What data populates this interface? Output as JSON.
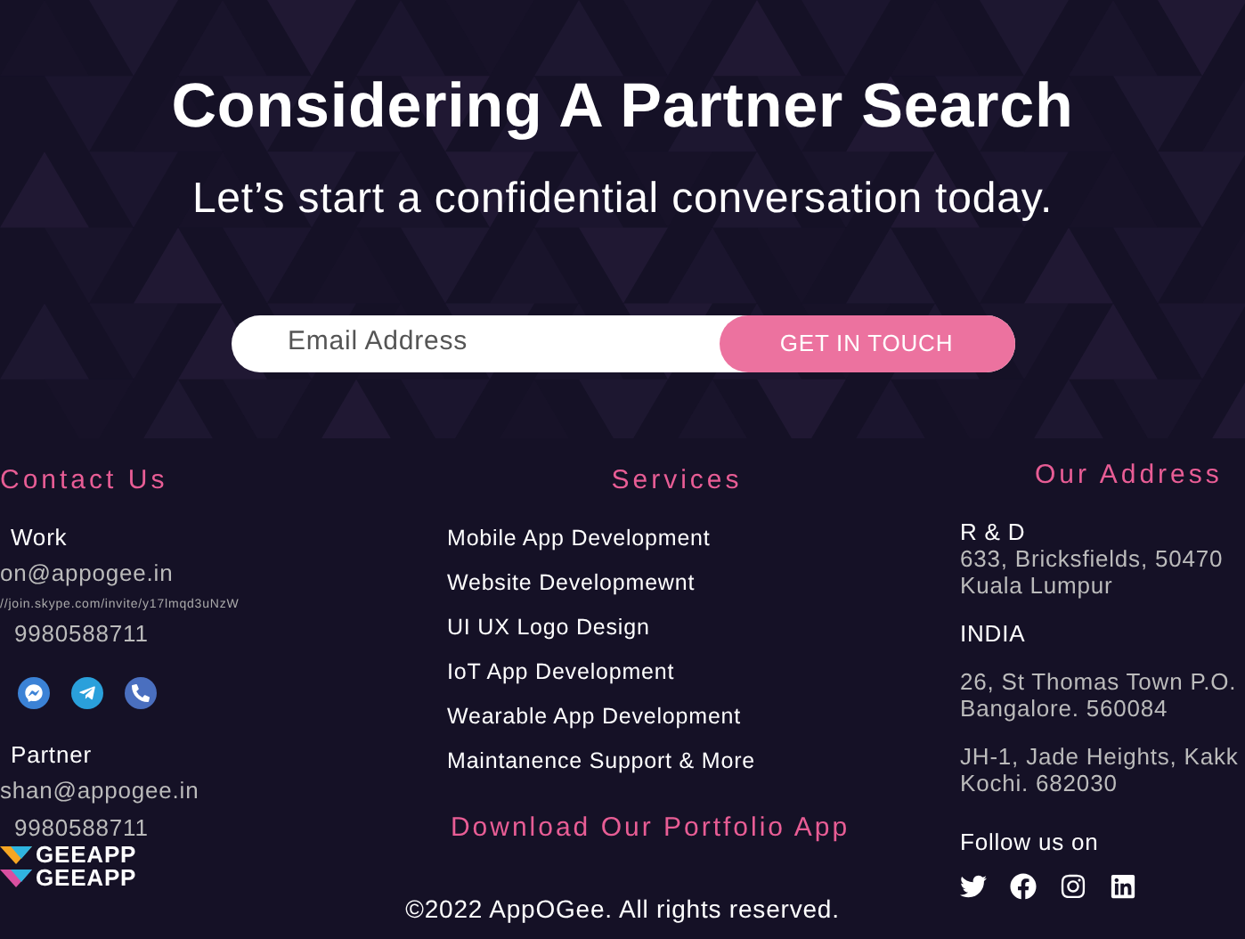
{
  "hero": {
    "title": "Considering A Partner Search",
    "subtitle": "Let’s start a confidential conversation today.",
    "email": {
      "placeholder": "Email Address"
    },
    "button": "GET IN TOUCH"
  },
  "contact": {
    "heading": "Contact Us",
    "groups": [
      {
        "label": "Work",
        "lines": [
          {
            "kind": "email",
            "text": "on@appogee.in"
          },
          {
            "kind": "link",
            "text": "//join.skype.com/invite/y17lmqd3uNzW"
          },
          {
            "kind": "phone",
            "text": "9980588711"
          }
        ],
        "quick_contact_icons": true
      },
      {
        "label": "Partner",
        "lines": [
          {
            "kind": "email",
            "text": "shan@appogee.in"
          },
          {
            "kind": "phone",
            "text": "9980588711"
          }
        ],
        "quick_contact_icons": false
      }
    ],
    "logos": [
      "GEEAPP",
      "GEEAPP"
    ]
  },
  "services": {
    "heading": "Services",
    "items": [
      "Mobile App Development",
      "Website Developmewnt",
      "UI UX Logo Design",
      "IoT App Development",
      "Wearable App Development",
      "Maintanence Support & More"
    ],
    "download": "Download Our Portfolio App"
  },
  "address": {
    "heading": "Our Address",
    "blocks": [
      {
        "label": "R & D",
        "lines": [
          "633, Bricksfields, 50470",
          "Kuala Lumpur"
        ]
      },
      {
        "label": "INDIA"
      },
      {
        "lines": [
          "26, St Thomas Town P.O.",
          "Bangalore. 560084"
        ]
      },
      {
        "lines": [
          "JH-1, Jade Heights, Kakk",
          "Kochi. 682030"
        ]
      }
    ],
    "follow": "Follow us on"
  },
  "footer": "©2022 AppOGee. All rights reserved."
}
